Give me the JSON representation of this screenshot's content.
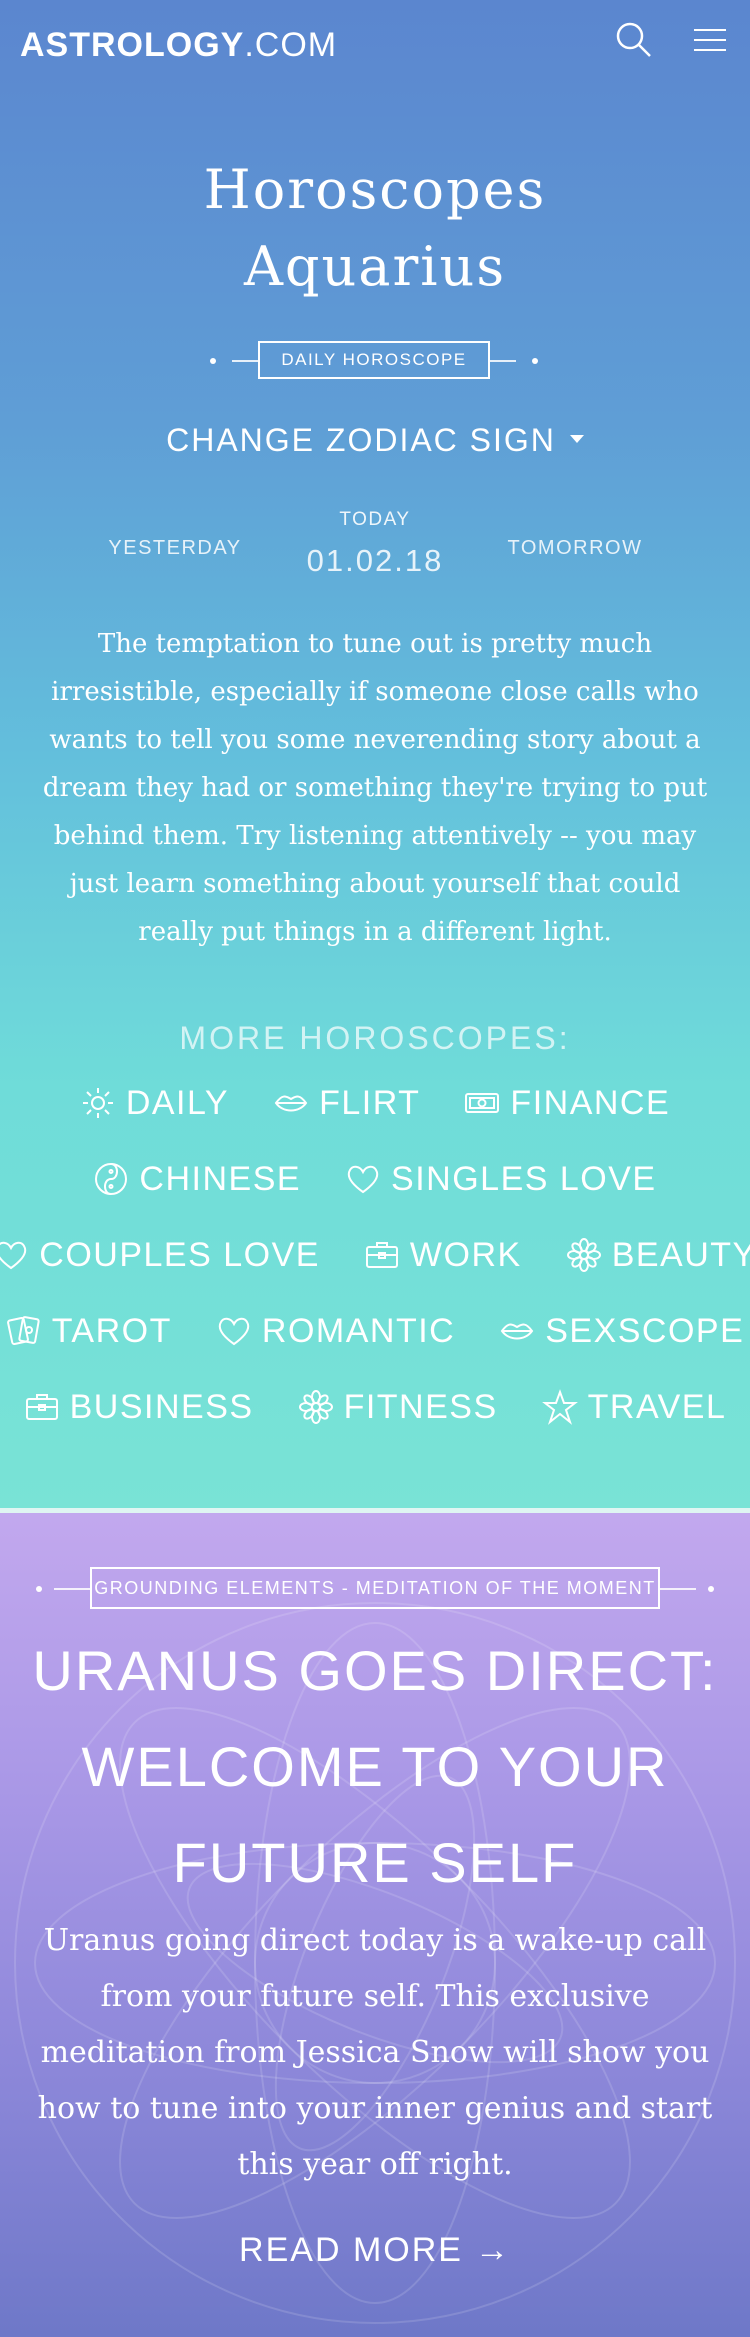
{
  "header": {
    "logo_main": "ASTROLOGY",
    "logo_suffix": ".COM",
    "search_icon": "search-icon",
    "menu_icon": "hamburger-menu-icon"
  },
  "page": {
    "title_line1": "Horoscopes",
    "title_line2": "Aquarius",
    "section_label": "DAILY HOROSCOPE",
    "change_sign": "CHANGE ZODIAC SIGN",
    "yesterday": "YESTERDAY",
    "today_label": "TODAY",
    "today_date": "01.02.18",
    "tomorrow": "TOMORROW",
    "horoscope_text": "The temptation to tune out is pretty much irresistible, especially if someone close calls who wants to tell you some neverending story about a dream they had or something they're trying to put behind them. Try listening attentively -- you may just learn something about yourself that could really put things in a different light."
  },
  "more": {
    "title": "MORE HOROSCOPES:",
    "links": [
      {
        "label": "DAILY",
        "icon": "sun-icon"
      },
      {
        "label": "FLIRT",
        "icon": "lips-icon"
      },
      {
        "label": "FINANCE",
        "icon": "money-icon"
      },
      {
        "label": "CHINESE",
        "icon": "yin-yang-icon"
      },
      {
        "label": "SINGLES LOVE",
        "icon": "heart-icon"
      },
      {
        "label": "COUPLES LOVE",
        "icon": "heart-icon"
      },
      {
        "label": "WORK",
        "icon": "briefcase-icon"
      },
      {
        "label": "BEAUTY",
        "icon": "flower-icon"
      },
      {
        "label": "TAROT",
        "icon": "tarot-cards-icon"
      },
      {
        "label": "ROMANTIC",
        "icon": "heart-icon"
      },
      {
        "label": "SEXSCOPE",
        "icon": "lips-icon"
      },
      {
        "label": "BUSINESS",
        "icon": "briefcase-icon"
      },
      {
        "label": "FITNESS",
        "icon": "flower-icon"
      },
      {
        "label": "TRAVEL",
        "icon": "star-icon"
      }
    ]
  },
  "article": {
    "category": "GROUNDING ELEMENTS - MEDITATION OF THE MOMENT",
    "title": "URANUS GOES DIRECT: WELCOME TO YOUR FUTURE SELF",
    "body": "Uranus going direct today is a wake-up call from your future self.  This exclusive meditation from Jessica Snow will show you how to tune into your inner genius and start this year off right.",
    "read_more": "READ MORE",
    "arrow_icon": "arrow-right-icon"
  }
}
